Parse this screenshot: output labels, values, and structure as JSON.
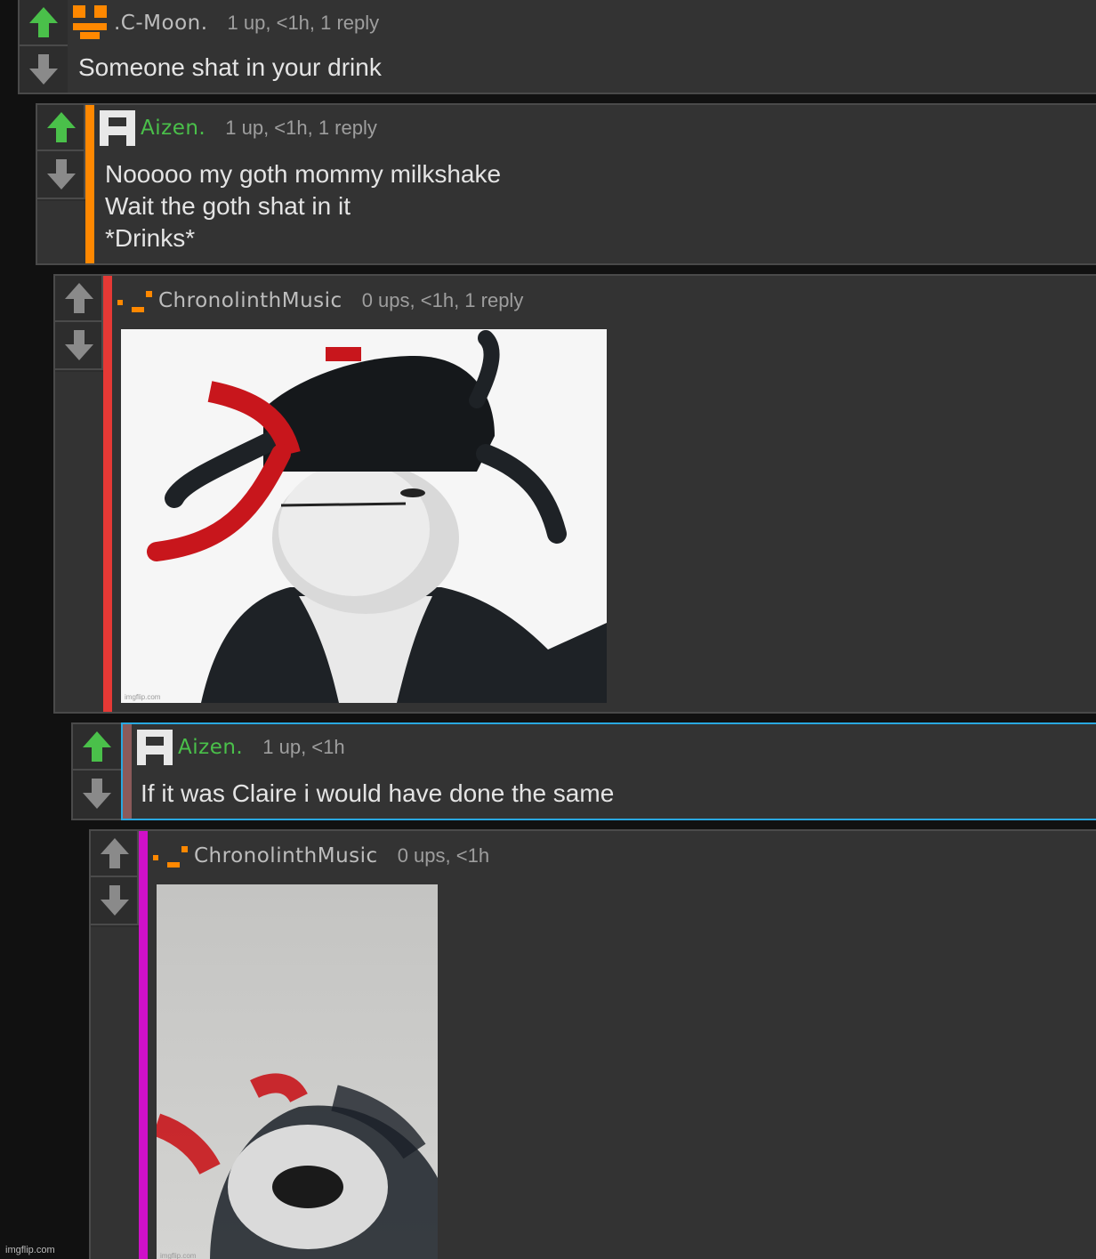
{
  "colors": {
    "background": "#111111",
    "panel": "#333333",
    "upvoted": "#4ac04a",
    "neutral_arrow": "#8a8a8a",
    "stripe_orange": "#ff8800",
    "stripe_red": "#e53935",
    "stripe_brown": "#8b5a5a",
    "stripe_magenta": "#d010c8",
    "highlight_border": "#29a8e0"
  },
  "comments": [
    {
      "username": ".C-Moon.",
      "meta": "1 up, <1h, 1 reply",
      "text": "Someone shat in your drink",
      "avatar_icon": "orange-pixel-face-icon",
      "upvoted": true
    },
    {
      "username": "Aizen.",
      "meta": "1 up, <1h, 1 reply",
      "lines": [
        "Nooooo my goth mommy milkshake",
        "Wait the goth shat in it",
        "*Drinks*"
      ],
      "avatar_icon": "white-pixel-a-icon",
      "upvoted": true
    },
    {
      "username": "ChronolinthMusic",
      "meta": "0 ups, <1h, 1 reply",
      "avatar_icon": "orange-pixel-steps-icon",
      "image_caption": "imgflip.com",
      "upvoted": false
    },
    {
      "username": "Aizen.",
      "meta": "1 up, <1h",
      "text": "If it was Claire i would have done the same",
      "avatar_icon": "white-pixel-a-icon",
      "upvoted": true
    },
    {
      "username": "ChronolinthMusic",
      "meta": "0 ups, <1h",
      "avatar_icon": "orange-pixel-steps-icon",
      "image_caption": "imgflip.com",
      "upvoted": false
    }
  ],
  "footer": {
    "watermark": "imgflip.com"
  }
}
